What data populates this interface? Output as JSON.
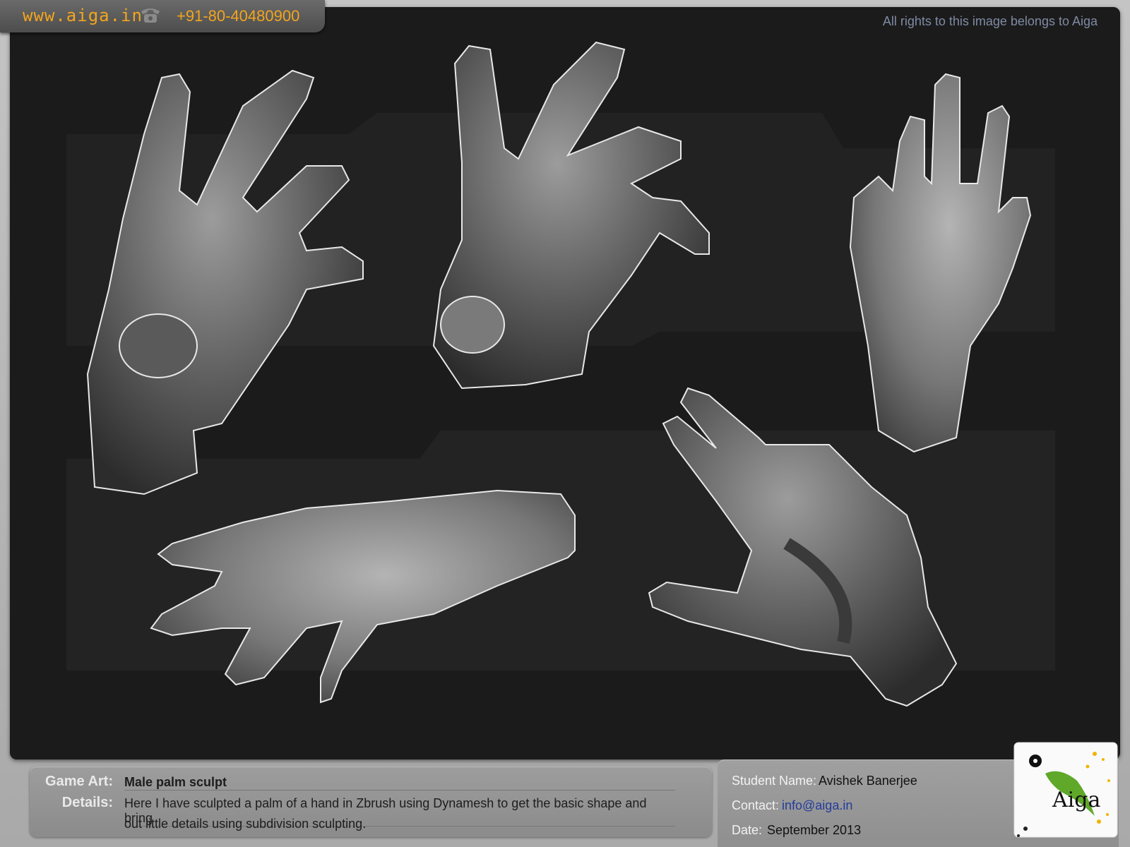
{
  "header": {
    "site": "www.aiga.in",
    "phone": "+91-80-40480900",
    "rights": "All rights to this image belongs to Aiga"
  },
  "project": {
    "category_label": "Game Art:",
    "title": "Male palm sculpt",
    "details_label": "Details:",
    "details_line1": "Here I have sculpted a palm of a hand in Zbrush using Dynamesh to get the basic shape and bring",
    "details_line2": "out little details using subdivision sculpting."
  },
  "student": {
    "name_label": "Student Name:",
    "name": "Avishek Banerjee",
    "contact_label": "Contact:",
    "contact": "info@aiga.in",
    "date_label": "Date:",
    "date": "September 2013"
  },
  "logo": {
    "text": "Aiga"
  },
  "icons": {
    "phone": "phone-icon"
  },
  "colors": {
    "accent": "#f2a51d",
    "stage": "#1c1c1c",
    "rights": "#7f8aa4",
    "link": "#233c9c"
  }
}
